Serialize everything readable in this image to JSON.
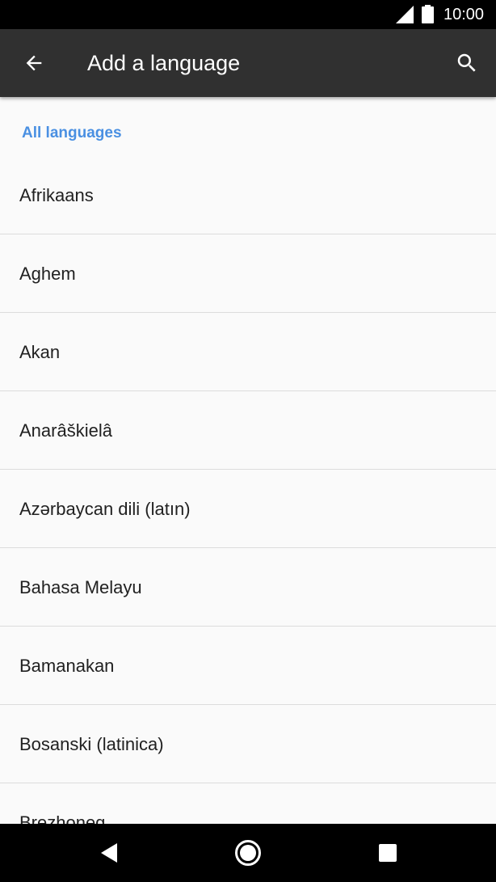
{
  "status_bar": {
    "time": "10:00",
    "icons": [
      "signal-icon",
      "battery-icon"
    ]
  },
  "app_bar": {
    "title": "Add a language",
    "back_icon": "arrow-back-icon",
    "search_icon": "search-icon"
  },
  "section": {
    "header": "All languages"
  },
  "languages": [
    "Afrikaans",
    "Aghem",
    "Akan",
    "Anarâškielâ",
    "Azərbaycan dili (latın)",
    "Bahasa Melayu",
    "Bamanakan",
    "Bosanski (latinica)",
    "Brezhoneg"
  ],
  "nav_bar": {
    "icons": [
      "nav-back-icon",
      "nav-home-icon",
      "nav-recents-icon"
    ]
  },
  "colors": {
    "status_bar": "#000000",
    "app_bar": "#303030",
    "accent": "#4a90e2",
    "background": "#fafafa",
    "divider": "#dcdcdc",
    "text_primary": "#212121"
  }
}
